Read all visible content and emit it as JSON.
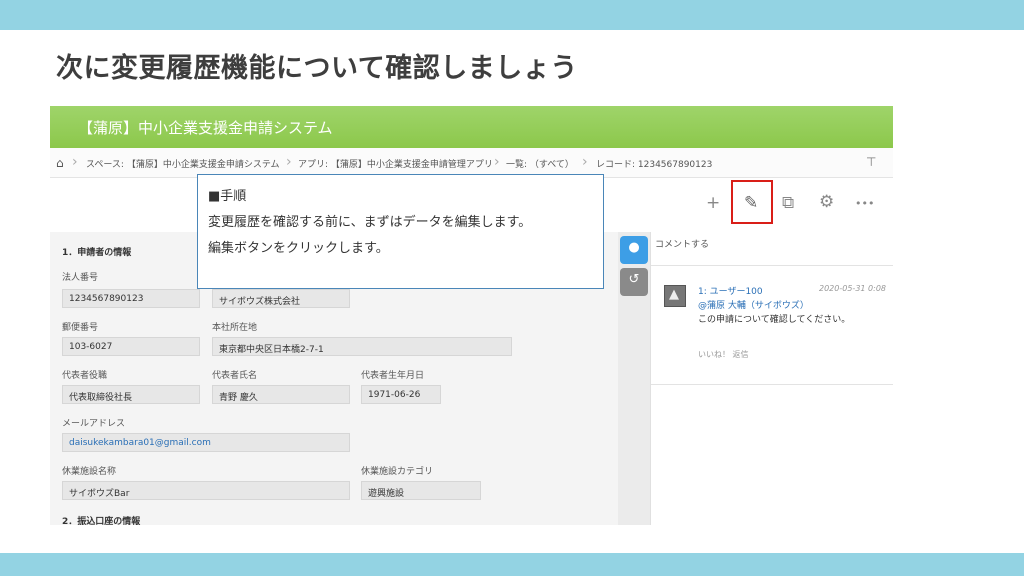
{
  "slide": {
    "title": "次に変更履歴機能について確認しましょう"
  },
  "app": {
    "title": "【蒲原】中小企業支援金申請システム"
  },
  "breadcrumb": {
    "space": "スペース: 【蒲原】中小企業支援金申請システム",
    "app": "アプリ: 【蒲原】中小企業支援金申請管理アプリ",
    "list": "一覧: （すべて）",
    "record": "レコード: 1234567890123"
  },
  "toolbar": {
    "icons": [
      "plus-icon",
      "edit-icon",
      "copy-icon",
      "gear-icon",
      "more-icon"
    ],
    "plus": "+",
    "edit": "✎",
    "copy": "⧉",
    "gear": "⚙",
    "more": "•••"
  },
  "form": {
    "section1": "1．申請者の情報",
    "section2": "2．振込口座の情報",
    "fields": {
      "corp_number": {
        "label": "法人番号",
        "value": "1234567890123"
      },
      "company": {
        "value": "サイボウズ株式会社"
      },
      "postal": {
        "label": "郵便番号",
        "value": "103-6027"
      },
      "address": {
        "label": "本社所在地",
        "value": "東京都中央区日本橋2-7-1"
      },
      "rep_title": {
        "label": "代表者役職",
        "value": "代表取締役社長"
      },
      "rep_name": {
        "label": "代表者氏名",
        "value": "青野 慶久"
      },
      "rep_birth": {
        "label": "代表者生年月日",
        "value": "1971-06-26"
      },
      "email": {
        "label": "メールアドレス",
        "value": "daisukekambara01@gmail.com"
      },
      "facility": {
        "label": "休業施設名称",
        "value": "サイボウズBar"
      },
      "facility_cat": {
        "label": "休業施設カテゴリ",
        "value": "遊興施設"
      }
    }
  },
  "comments": {
    "title": "コメントする",
    "item": {
      "number_user": "1: ユーザー100",
      "date": "2020-05-31 0:08",
      "mention": "@蒲原 大輔（サイボウズ）",
      "body": "この申請について確認してください。",
      "actions": "いいね！  返信"
    }
  },
  "callout": {
    "heading": "■手順",
    "line1": "変更履歴を確認する前に、まずはデータを編集します。",
    "line2": "編集ボタンをクリックします。"
  },
  "colors": {
    "band": "#93d3e3",
    "header_green": "#8cc84b",
    "highlight_red": "#d91e18",
    "comment_tab_blue": "#3d9ee6"
  }
}
